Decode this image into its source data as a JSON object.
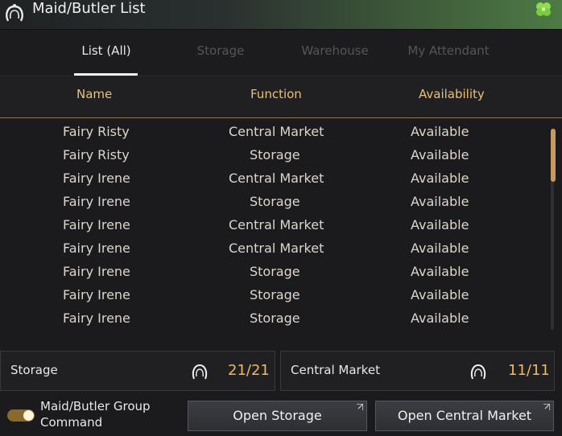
{
  "window": {
    "title": "Maid/Butler List",
    "title_icon": "maid-icon",
    "corner_icon": "clover-icon"
  },
  "tabs": [
    {
      "label": "List (All)",
      "active": true
    },
    {
      "label": "Storage",
      "active": false
    },
    {
      "label": "Warehouse",
      "active": false
    },
    {
      "label": "My Attendant",
      "active": false
    }
  ],
  "columns": {
    "name": "Name",
    "function": "Function",
    "availability": "Availability"
  },
  "rows": [
    {
      "name": "Fairy Risty",
      "function": "Central Market",
      "availability": "Available"
    },
    {
      "name": "Fairy Risty",
      "function": "Storage",
      "availability": "Available"
    },
    {
      "name": "Fairy Irene",
      "function": "Central Market",
      "availability": "Available"
    },
    {
      "name": "Fairy Irene",
      "function": "Storage",
      "availability": "Available"
    },
    {
      "name": "Fairy Irene",
      "function": "Central Market",
      "availability": "Available"
    },
    {
      "name": "Fairy Irene",
      "function": "Central Market",
      "availability": "Available"
    },
    {
      "name": "Fairy Irene",
      "function": "Storage",
      "availability": "Available"
    },
    {
      "name": "Fairy Irene",
      "function": "Storage",
      "availability": "Available"
    },
    {
      "name": "Fairy Irene",
      "function": "Storage",
      "availability": "Available"
    }
  ],
  "summary": {
    "storage": {
      "label": "Storage",
      "count": "21/21"
    },
    "market": {
      "label": "Central Market",
      "count": "11/11"
    }
  },
  "footer": {
    "group_label_line1": "Maid/Butler Group",
    "group_label_line2": "Command",
    "toggle_on": true,
    "open_storage": "Open Storage",
    "open_market": "Open Central Market"
  },
  "colors": {
    "accent": "#f0b860",
    "header_text": "#e8c07a",
    "scroll_thumb": "#c79a63"
  }
}
